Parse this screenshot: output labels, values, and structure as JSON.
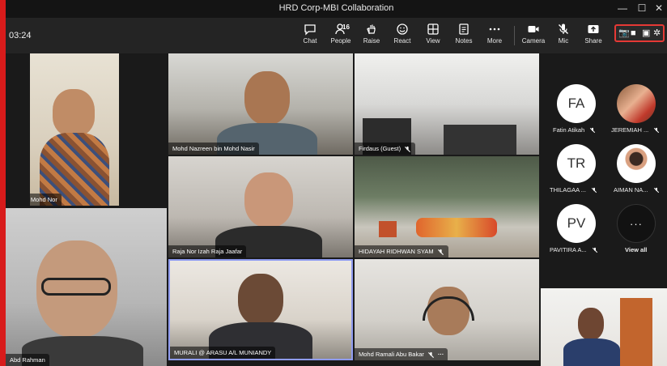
{
  "window": {
    "title": "HRD Corp-MBI Collaboration",
    "controls": {
      "minimize": "—",
      "maximize": "☐",
      "close": "✕"
    }
  },
  "toolbar": {
    "timer": "03:24",
    "chat": "Chat",
    "people": "People",
    "people_count": "16",
    "raise": "Raise",
    "react": "React",
    "view": "View",
    "notes": "Notes",
    "more": "More",
    "camera": "Camera",
    "mic": "Mic",
    "share": "Share"
  },
  "recording_icons": {
    "camera": "📷",
    "video": "■",
    "gallery": "▣",
    "settings": "✲"
  },
  "tiles": [
    {
      "name": "ib Mohd Nor",
      "muted": false,
      "more": false
    },
    {
      "name": "Mohd Nazreen bin Mohd Nasir",
      "muted": false,
      "more": false
    },
    {
      "name": "Firdaus (Guest)",
      "muted": true,
      "more": false
    },
    {
      "name": "Raja Nor Izah Raja Jaafar",
      "muted": false,
      "more": false
    },
    {
      "name": "HIDAYAH RIDHWAN SYAM",
      "muted": true,
      "more": false
    },
    {
      "name": "Abd Rahman",
      "muted": false,
      "more": false
    },
    {
      "name": "MURALI @ ARASU A/L MUNIANDY",
      "muted": false,
      "more": false
    },
    {
      "name": "Mohd Ramali Abu Bakar",
      "muted": true,
      "more": true
    },
    {
      "name": "",
      "muted": false,
      "more": false
    }
  ],
  "roster": [
    {
      "initials": "FA",
      "name": "Fatin Atikah",
      "muted": true
    },
    {
      "initials": "",
      "name": "JEREMIAH ...",
      "muted": true
    },
    {
      "initials": "TR",
      "name": "THILAGAA ...",
      "muted": true
    },
    {
      "initials": "",
      "name": "AIMAN NA...",
      "muted": true
    },
    {
      "initials": "PV",
      "name": "PAVITIRA A...",
      "muted": true
    },
    {
      "initials": "···",
      "name": "View all",
      "muted": false
    }
  ],
  "colors": {
    "accent": "#e53935",
    "active_tile": "#8f9bf0",
    "toolbar": "#242424"
  }
}
